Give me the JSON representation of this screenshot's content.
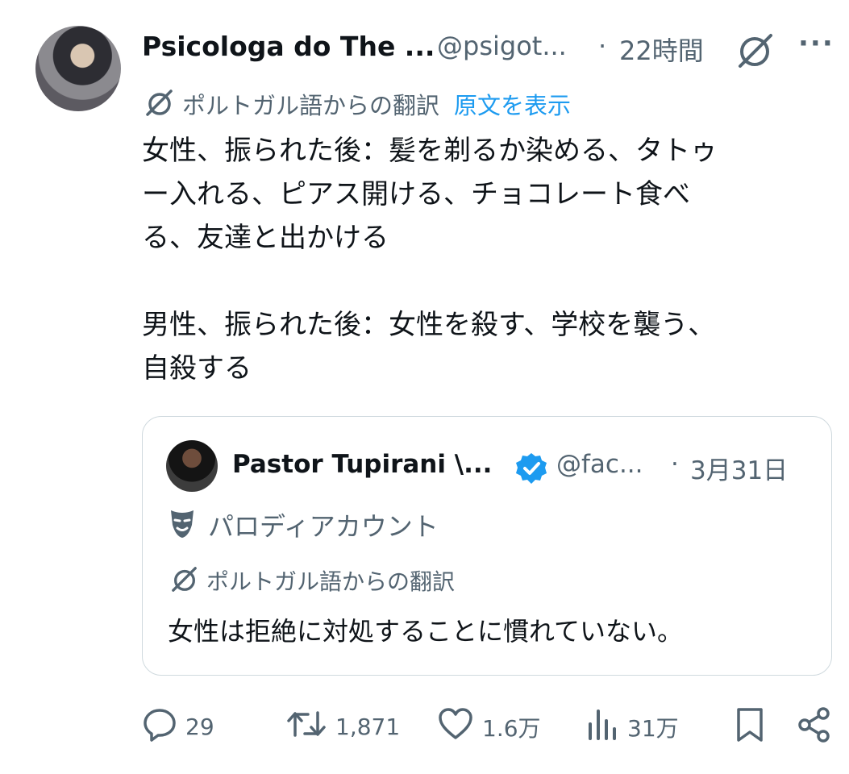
{
  "post": {
    "display_name": "Psicologa do The ...",
    "handle": "@psigot...",
    "separator": "·",
    "time": "22時間",
    "more_label": "···",
    "translation_label": "ポルトガル語からの翻訳",
    "show_original": "原文を表示",
    "text": "女性、振られた後：髪を剃るか染める、タトゥ\nー入れる、ピアス開ける、チョコレート食べ\nる、友達と出かける\n\n男性、振られた後：女性を殺す、学校を襲う、\n自殺する"
  },
  "quote": {
    "display_name": "Pastor Tupirani \\...",
    "handle": "@fac...",
    "separator": "·",
    "time": "3月31日",
    "parody_label": "パロディアカウント",
    "translation_label": "ポルトガル語からの翻訳",
    "text": "女性は拒絶に対処することに慣れていない。"
  },
  "actions": {
    "replies": "29",
    "reposts": "1,871",
    "likes": "1.6万",
    "views": "31万"
  },
  "colors": {
    "muted": "#536471",
    "link": "#1d9bf0",
    "verified": "#1d9bf0",
    "text": "#0f1419"
  },
  "icons": [
    "grok-icon",
    "more-icon",
    "translate-icon",
    "verified-badge-icon",
    "parody-mask-icon",
    "reply-icon",
    "repost-icon",
    "like-icon",
    "views-icon",
    "bookmark-icon",
    "share-icon"
  ]
}
